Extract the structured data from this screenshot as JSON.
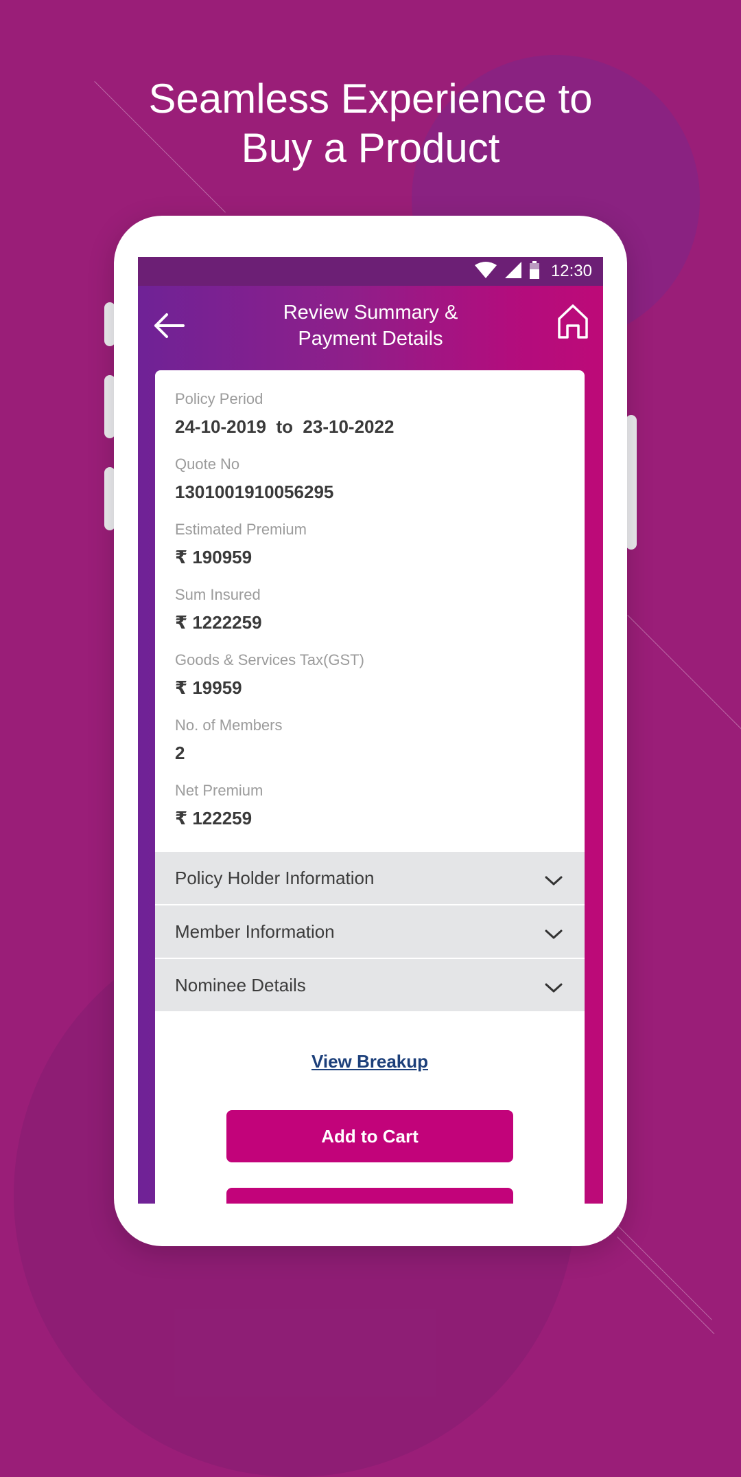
{
  "headline": {
    "line1": "Seamless Experience to",
    "line2": "Buy a Product"
  },
  "status_bar": {
    "time": "12:30",
    "icons": [
      "wifi-icon",
      "signal-icon",
      "battery-icon"
    ]
  },
  "app_bar": {
    "title_line1": "Review Summary &",
    "title_line2": "Payment Details",
    "back_icon": "arrow-left-icon",
    "home_icon": "home-icon"
  },
  "summary": {
    "fields": [
      {
        "label": "Policy Period",
        "value": "24-10-2019  to  23-10-2022"
      },
      {
        "label": "Quote No",
        "value": "1301001910056295"
      },
      {
        "label": "Estimated Premium",
        "value": "₹ 190959"
      },
      {
        "label": "Sum Insured",
        "value": "₹ 1222259"
      },
      {
        "label": "Goods & Services Tax(GST)",
        "value": "₹ 19959"
      },
      {
        "label": "No. of Members",
        "value": "2"
      },
      {
        "label": "Net Premium",
        "value": "₹ 122259"
      }
    ]
  },
  "sections": [
    {
      "label": "Policy Holder Information",
      "icon": "chevron-down-icon"
    },
    {
      "label": "Member Information",
      "icon": "chevron-down-icon"
    },
    {
      "label": "Nominee Details",
      "icon": "chevron-down-icon"
    }
  ],
  "actions": {
    "view_breakup": "View Breakup",
    "add_to_cart": "Add to Cart"
  },
  "colors": {
    "background": "#9a1e78",
    "status_bar": "#6c1f75",
    "primary_button": "#c2037a",
    "link": "#1c3f7a",
    "accordion": "#e4e5e7"
  }
}
